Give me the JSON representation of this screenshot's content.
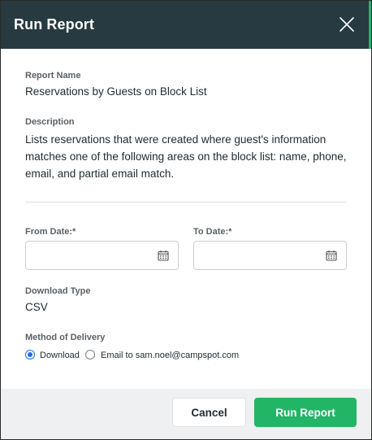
{
  "header": {
    "title": "Run Report",
    "accent_color": "#2ab26b",
    "background_color": "#273a42",
    "close_icon": "close-icon"
  },
  "report": {
    "name_label": "Report Name",
    "name_value": "Reservations by Guests on Block List",
    "description_label": "Description",
    "description_value": "Lists reservations that were created where guest's information matches one of the following areas on the block list: name, phone, email, and partial email match."
  },
  "dates": {
    "from_label": "From Date:*",
    "from_value": "",
    "to_label": "To Date:*",
    "to_value": "",
    "icon": "calendar-icon"
  },
  "download": {
    "label": "Download Type",
    "value": "CSV"
  },
  "delivery": {
    "label": "Method of Delivery",
    "options": [
      {
        "label": "Download",
        "selected": true
      },
      {
        "label": "Email to sam.noel@campspot.com",
        "selected": false
      }
    ]
  },
  "footer": {
    "cancel_label": "Cancel",
    "run_label": "Run Report",
    "run_color": "#22b566"
  }
}
